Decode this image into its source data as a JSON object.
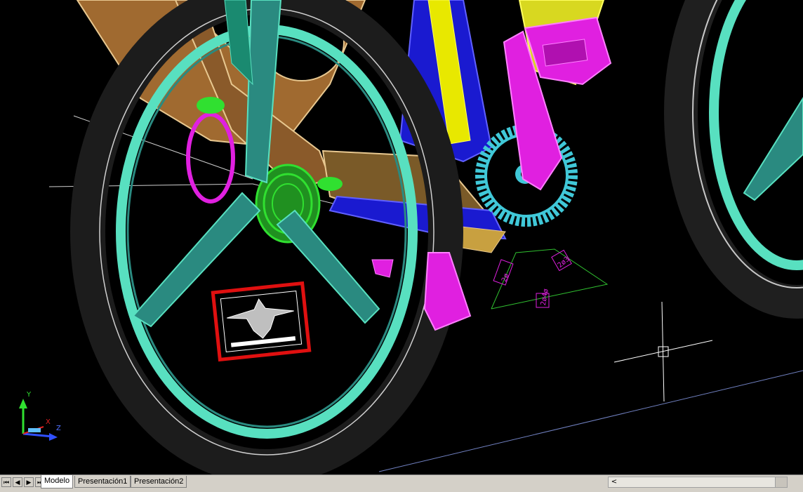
{
  "app": {
    "name": "AutoCAD model viewport"
  },
  "colors": {
    "background": "#000000",
    "tire": "#1a1a1a",
    "rim": "#58e0c0",
    "frame_brown": "#8a5a2a",
    "frame_tan": "#e8c890",
    "frame_blue": "#1a1ad0",
    "frame_yellow": "#e8e800",
    "crank_magenta": "#e020e0",
    "chainring_cyan": "#40c8d8",
    "cassette_green": "#30e030",
    "dimension_green": "#30c030",
    "badge_red": "#e01010"
  },
  "dimensions": {
    "left": "2ø",
    "right": "2ø3",
    "bottom": "2ø4ø"
  },
  "ucs": {
    "y_label": "Y",
    "x_label": "X",
    "z_label": "Z"
  },
  "tabbar": {
    "nav_first": "⏮",
    "nav_prev": "◀",
    "nav_next": "▶",
    "nav_last": "⏭",
    "tabs": [
      {
        "label": "Modelo",
        "active": true
      },
      {
        "label": "Presentación1",
        "active": false
      },
      {
        "label": "Presentación2",
        "active": false
      }
    ],
    "scroll_left": "<"
  }
}
